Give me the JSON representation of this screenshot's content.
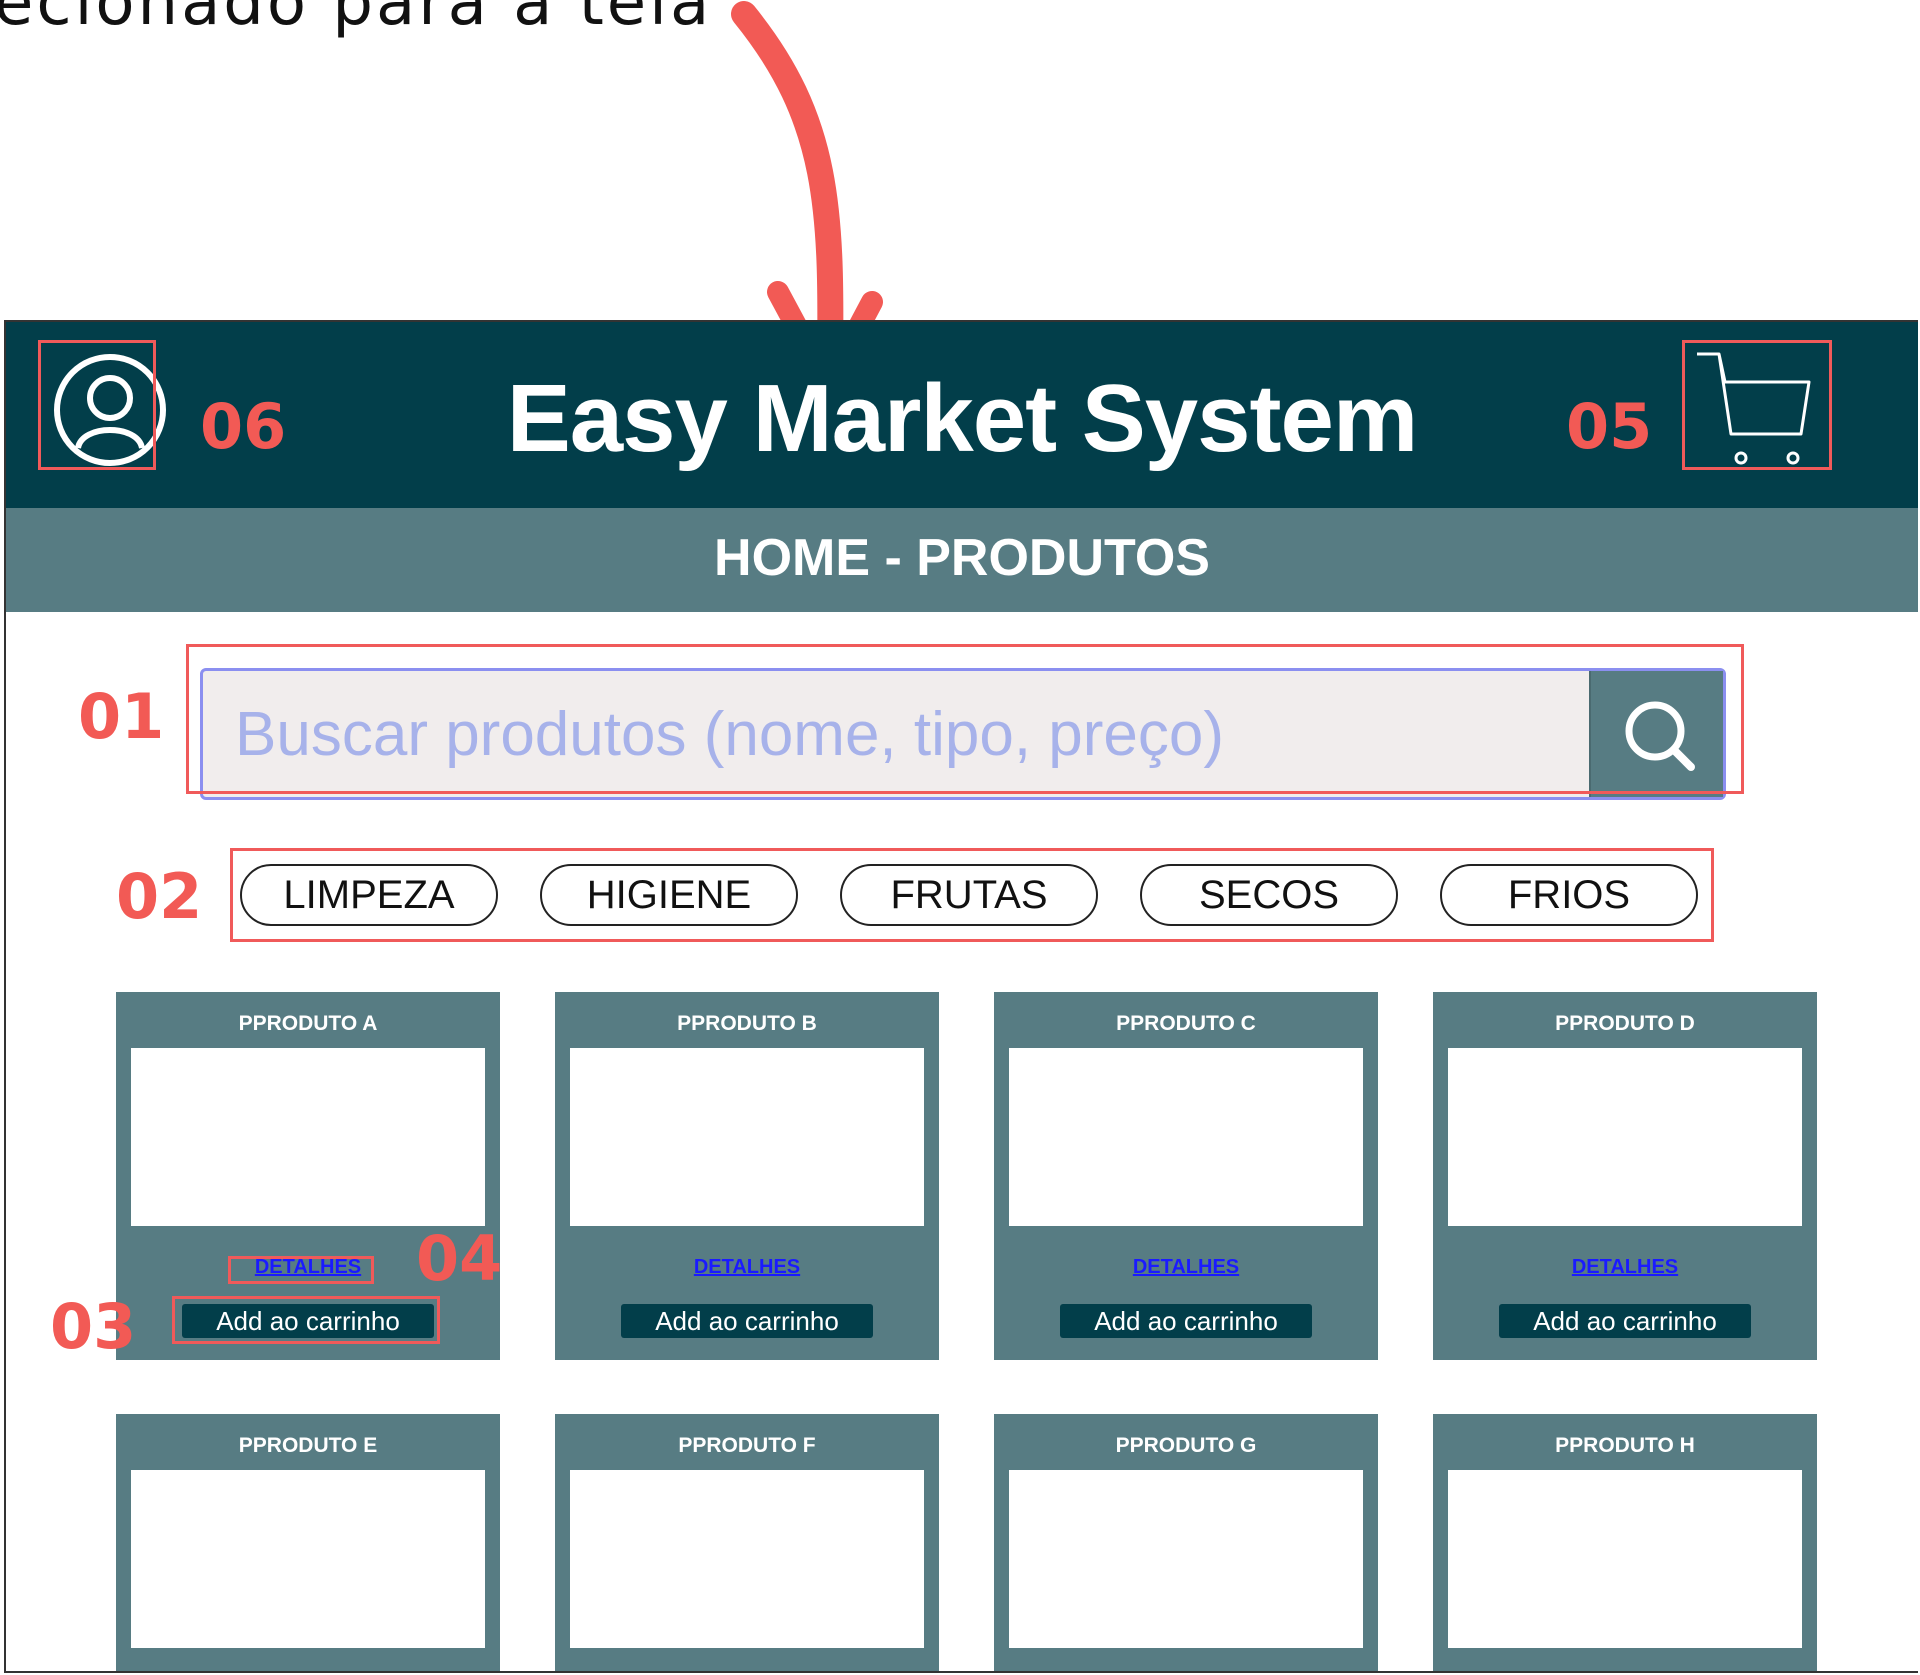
{
  "annotation": {
    "caption": "ecionado para a tela",
    "numbers": {
      "search": "01",
      "categories": "02",
      "add_to_cart": "03",
      "details": "04",
      "cart": "05",
      "user": "06"
    },
    "color": "#f25a55"
  },
  "header": {
    "title": "Easy Market System",
    "user_icon": "user-circle-icon",
    "cart_icon": "shopping-cart-icon",
    "background": "#023e4a"
  },
  "subheader": {
    "title": "HOME - PRODUTOS",
    "background": "#577c83"
  },
  "search": {
    "placeholder": "Buscar produtos (nome, tipo, preço)",
    "value": "",
    "icon": "search-icon"
  },
  "categories": [
    "LIMPEZA",
    "HIGIENE",
    "FRUTAS",
    "SECOS",
    "FRIOS"
  ],
  "products": [
    {
      "name": "PPRODUTO A",
      "details_label": "DETALHES",
      "button_label": "Add ao carrinho"
    },
    {
      "name": "PPRODUTO B",
      "details_label": "DETALHES",
      "button_label": "Add ao carrinho"
    },
    {
      "name": "PPRODUTO C",
      "details_label": "DETALHES",
      "button_label": "Add ao carrinho"
    },
    {
      "name": "PPRODUTO D",
      "details_label": "DETALHES",
      "button_label": "Add ao carrinho"
    },
    {
      "name": "PPRODUTO E"
    },
    {
      "name": "PPRODUTO F"
    },
    {
      "name": "PPRODUTO G"
    },
    {
      "name": "PPRODUTO H"
    }
  ]
}
